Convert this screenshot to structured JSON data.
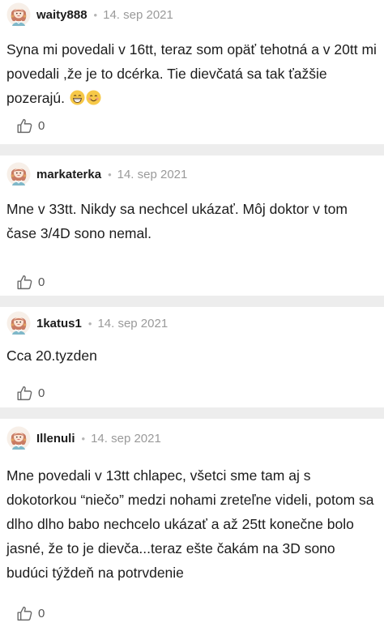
{
  "comments": [
    {
      "author": "waity888",
      "separator": "•",
      "date": "14. sep 2021",
      "text": "Syna mi povedali v 16tt, teraz som opäť tehotná a v 20tt mi povedali ,že je to dcérka. Tie dievčatá sa tak ťažšie pozerajú.",
      "emoji": [
        "grinning-face-emoji",
        "smiling-face-emoji"
      ],
      "likes": "0"
    },
    {
      "author": "markaterka",
      "separator": "•",
      "date": "14. sep 2021",
      "text": "Mne v 33tt. Nikdy sa nechcel ukázať. Môj doktor v tom čase 3/4D sono nemal.",
      "likes": "0"
    },
    {
      "author": "1katus1",
      "separator": "•",
      "date": "14. sep 2021",
      "text": "Cca 20.tyzden",
      "likes": "0"
    },
    {
      "author": "Illenuli",
      "separator": "•",
      "date": "14. sep 2021",
      "text": "Mne povedali v 13tt chlapec, všetci sme tam aj s dokotorkou “niečo” medzi nohami zreteľne videli, potom sa dlho dlho babo nechcelo ukázať a až 25tt konečne bolo jasné, že to je dievča...teraz ešte čakám na 3D sono budúci týždeň na potrvdenie",
      "likes": "0"
    }
  ],
  "icons": {
    "avatar": "avatar-icon",
    "like": "thumbs-up-icon"
  },
  "colors": {
    "text": "#1c1c1c",
    "meta": "#9a9a9a",
    "separator_band": "#ededed",
    "avatar_hair": "#c97b63",
    "avatar_dress": "#7fb8c9"
  }
}
